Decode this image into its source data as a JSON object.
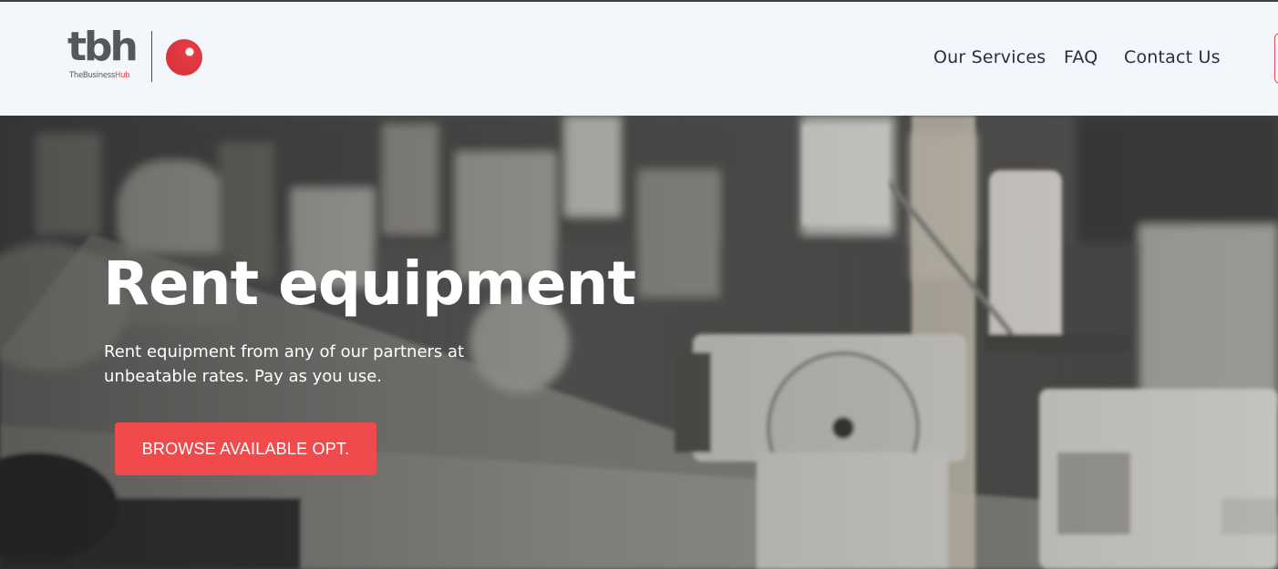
{
  "header": {
    "logo": {
      "wordmark": "tbh",
      "tagline_prefix": "TheBusiness",
      "tagline_accent": "Hub"
    },
    "nav": [
      {
        "label": "Our Services"
      },
      {
        "label": "FAQ"
      },
      {
        "label": "Contact Us"
      }
    ]
  },
  "hero": {
    "title": "Rent equipment",
    "subtitle": "Rent equipment from any of our partners at unbeatable rates. Pay as you use.",
    "button_label": "BROWSE AVAILABLE OPT."
  },
  "colors": {
    "accent": "#f04a4c",
    "logo_dot": "#e53c44",
    "nav_text": "#2b2f3a",
    "header_bg": "#f3f6fb"
  },
  "icons": {
    "logo_mark": "red-dot-icon"
  }
}
